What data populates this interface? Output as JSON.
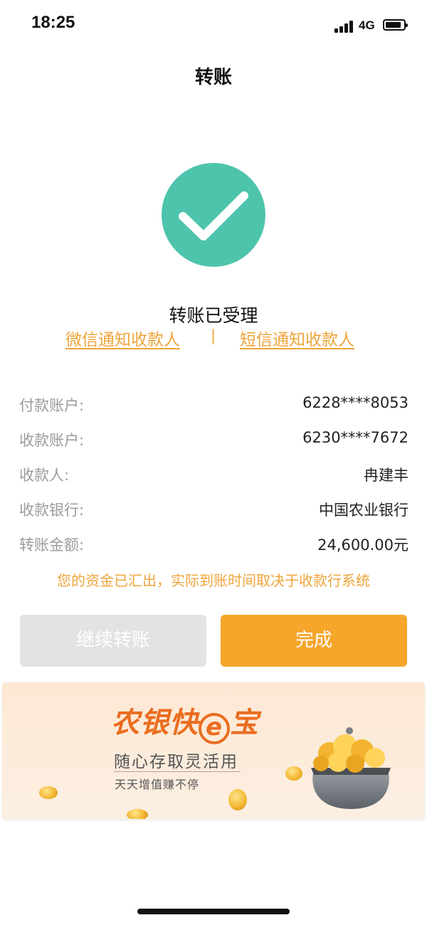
{
  "status_bar": {
    "time": "18:25",
    "network": "4G"
  },
  "nav": {
    "title": "转账"
  },
  "result": {
    "icon": "check-circle-icon",
    "text": "转账已受理",
    "wechat_notify": "微信通知收款人",
    "separator": "|",
    "sms_notify": "短信通知收款人"
  },
  "details": [
    {
      "label": "付款账户:",
      "value": "6228****8053"
    },
    {
      "label": "收款账户:",
      "value": "6230****7672"
    },
    {
      "label": "收款人:",
      "value": "冉建丰"
    },
    {
      "label": "收款银行:",
      "value": "中国农业银行"
    },
    {
      "label": "转账金额:",
      "value": "24,600.00元"
    }
  ],
  "notice": "您的资金已汇出，实际到账时间取决于收款行系统",
  "buttons": {
    "continue": "继续转账",
    "done": "完成"
  },
  "banner": {
    "brand_prefix": "农银快",
    "brand_e": "e",
    "brand_suffix": "宝",
    "slogan": "随心存取灵活用",
    "sub": "天天增值赚不停"
  },
  "colors": {
    "accent": "#f5a62b",
    "success": "#4ec4ad",
    "link": "#eea43a",
    "brand": "#ea6d1f"
  }
}
